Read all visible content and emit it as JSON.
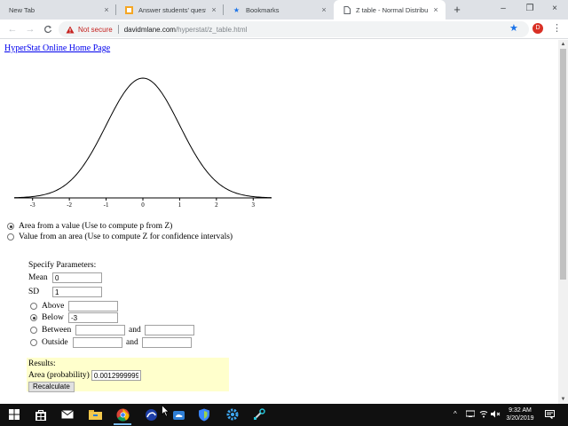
{
  "browser": {
    "tabs": [
      {
        "label": "New Tab",
        "close": "×"
      },
      {
        "label": "Answer students' questio",
        "close": "×"
      },
      {
        "label": "Bookmarks",
        "close": "×"
      },
      {
        "label": "Z table - Normal Distribu",
        "close": "×"
      }
    ],
    "new_tab": "+",
    "window_controls": {
      "minimize": "–",
      "maximize": "❐",
      "close": "×"
    },
    "nav": {
      "back": "←",
      "forward": "→",
      "reload": "C"
    },
    "security_label": "Not secure",
    "url_host": "davidmlane.com",
    "url_path": "/hyperstat/z_table.html",
    "profile_initial": "D",
    "menu": "⋮",
    "star": "★"
  },
  "page": {
    "home_link": "HyperStat Online Home Page",
    "chart_data": {
      "type": "line",
      "title": "",
      "xlabel": "",
      "ylabel": "",
      "x_ticks": [
        "-3",
        "-2",
        "-1",
        "0",
        "1",
        "2",
        "3"
      ],
      "xlim": [
        -3.5,
        3.5
      ],
      "series": [
        {
          "function": "standard normal density",
          "mean": 0,
          "sd": 1
        }
      ]
    },
    "mode_options": [
      {
        "label": "Area from a value (Use to compute p from Z)",
        "checked": true
      },
      {
        "label": "Value from an area (Use to compute Z for confidence intervals)",
        "checked": false
      }
    ],
    "params": {
      "title": "Specify Parameters:",
      "mean_label": "Mean",
      "mean_value": "0",
      "sd_label": "SD",
      "sd_value": "1",
      "above_label": "Above",
      "above_value": "",
      "below_label": "Below",
      "below_value": "-3",
      "between_label": "Between",
      "outside_label": "Outside",
      "and_label": "and"
    },
    "results": {
      "title": "Results:",
      "area_label": "Area (probability)",
      "area_value": "0.0012999999",
      "recalc_label": "Recalculate"
    }
  },
  "taskbar": {
    "time": "9:32 AM",
    "date": "3/20/2019",
    "tray_chevron": "^"
  },
  "colors": {
    "tabstrip": "#dee1e6",
    "link": "#0000ee",
    "not_secure": "#c5221f",
    "results_bg": "#ffffcc",
    "taskbar": "#101010"
  }
}
